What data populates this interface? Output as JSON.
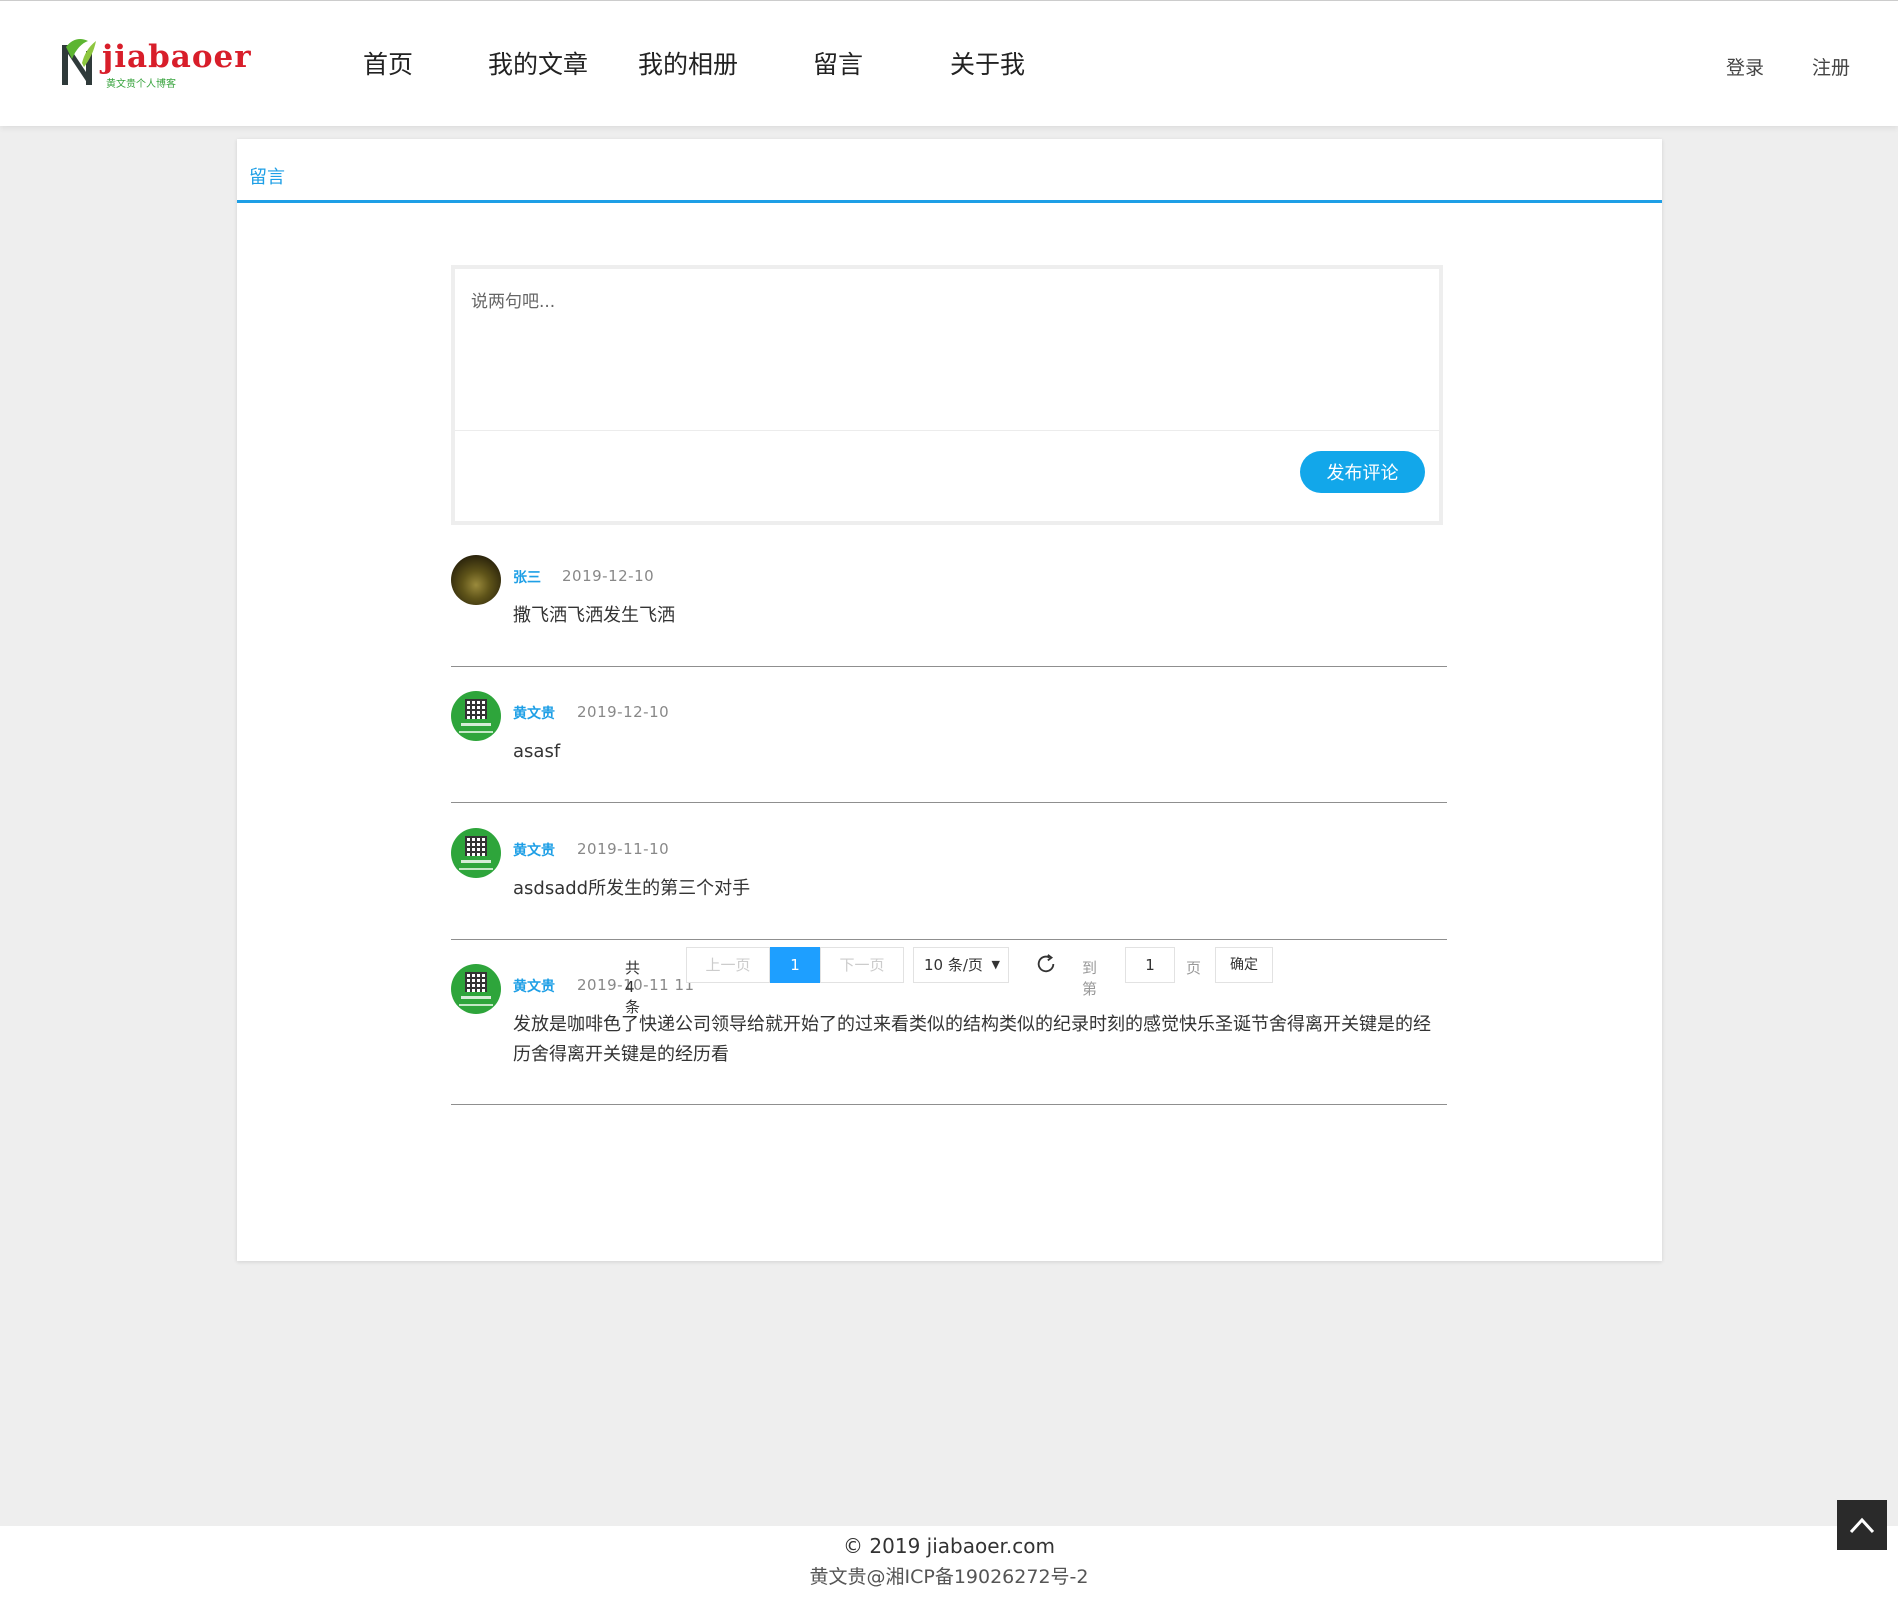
{
  "header": {
    "logo_text": "jiabaoer",
    "logo_tagline": "黄文贵个人博客",
    "nav": [
      "首页",
      "我的文章",
      "我的相册",
      "留言",
      "关于我"
    ],
    "login": "登录",
    "register": "注册"
  },
  "board": {
    "tab": "留言",
    "placeholder": "说两句吧...",
    "publish": "发布评论"
  },
  "comments": [
    {
      "author": "张三",
      "date": "2019-12-10",
      "text": "撒飞洒飞洒发生飞洒",
      "avatar": "photo"
    },
    {
      "author": "黄文贵",
      "date": "2019-12-10",
      "text": "asasf",
      "avatar": "qr-code"
    },
    {
      "author": "黄文贵",
      "date": "2019-11-10",
      "text": "asdsadd所发生的第三个对手",
      "avatar": "qr-code"
    },
    {
      "author": "黄文贵",
      "date": "2019-10-11 11",
      "text": "发放是咖啡色了快递公司领导给就开始了的过来看类似的结构类似的纪录时刻的感觉快乐圣诞节舍得离开关键是的经历舍得离开关键是的经历看",
      "avatar": "qr-code"
    }
  ],
  "pagination": {
    "total": "共 4 条",
    "prev": "上一页",
    "current": "1",
    "next": "下一页",
    "page_size": "10 条/页",
    "goto": "到第",
    "goto_value": "1",
    "page_unit": "页",
    "confirm": "确定"
  },
  "footer": {
    "copyright": "© 2019  jiabaoer.com",
    "icp": "黄文贵@湘ICP备19026272号-2"
  },
  "colors": {
    "accent": "#1e9fe6",
    "publish_button": "#12a7ea",
    "pager_current": "#1e9fff",
    "logo_red": "#d81e2a",
    "logo_green": "#38a43e"
  },
  "icons": [
    "logo-mark-icon",
    "refresh-icon",
    "caret-down-icon",
    "chevron-up-icon"
  ]
}
